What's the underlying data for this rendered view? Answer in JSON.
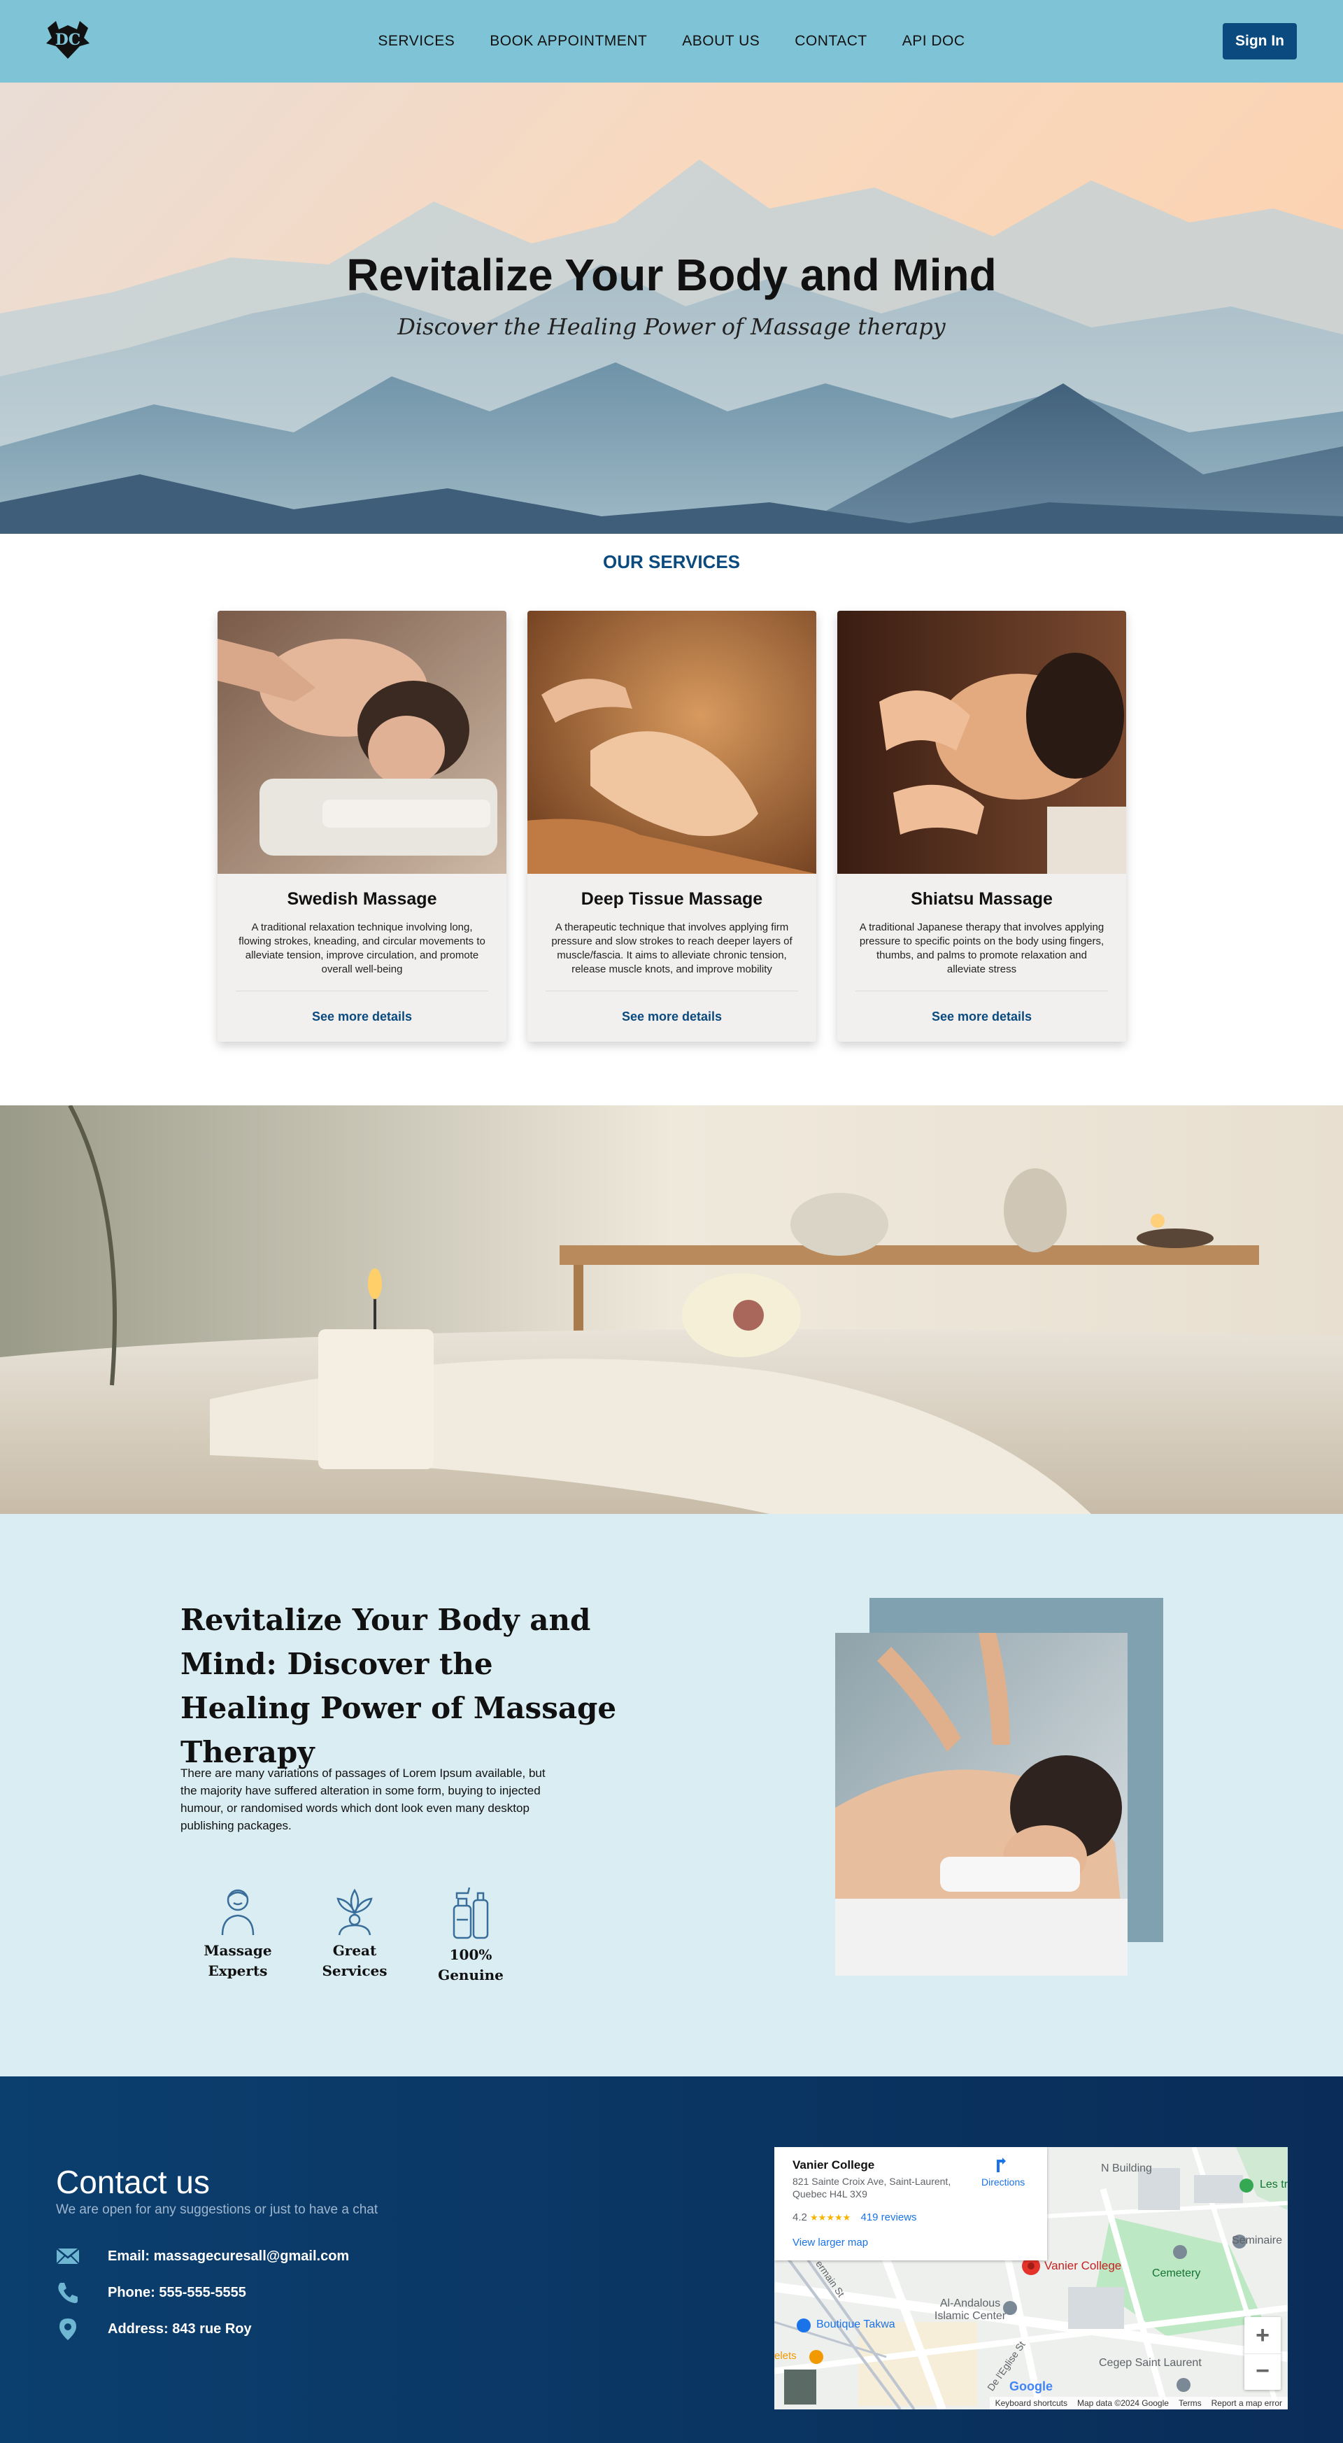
{
  "header": {
    "nav": [
      "SERVICES",
      "BOOK APPOINTMENT",
      "ABOUT US",
      "CONTACT",
      "API DOC"
    ],
    "sign_in": "Sign In"
  },
  "hero": {
    "title": "Revitalize Your Body and Mind",
    "subtitle": "Discover the Healing Power of Massage therapy"
  },
  "services": {
    "title": "OUR SERVICES",
    "cards": [
      {
        "title": "Swedish Massage",
        "desc": "A traditional relaxation technique involving long, flowing strokes, kneading, and circular movements to alleviate tension, improve circulation, and promote overall well-being",
        "link": "See more details"
      },
      {
        "title": "Deep Tissue Massage",
        "desc": "A therapeutic technique that involves applying firm pressure and slow strokes to reach deeper layers of muscle/fascia. It aims to alleviate chronic tension, release muscle knots, and improve mobility",
        "link": "See more details"
      },
      {
        "title": "Shiatsu Massage",
        "desc": "A traditional Japanese therapy that involves applying pressure to specific points on the body using fingers, thumbs, and palms to promote relaxation and alleviate stress",
        "link": "See more details"
      }
    ]
  },
  "about": {
    "title": "Revitalize Your Body and Mind: Discover the Healing Power of Massage Therapy",
    "body": "There are many variations of passages of Lorem Ipsum available, but the majority have suffered alteration in some form, buying to injected humour, or randomised words which dont look even many desktop publishing packages.",
    "features": [
      {
        "icon": "therapist-icon",
        "label": "Massage Experts"
      },
      {
        "icon": "lotus-icon",
        "label": "Great Services"
      },
      {
        "icon": "bottles-icon",
        "label": "100% Genuine"
      }
    ]
  },
  "contact": {
    "title": "Contact us",
    "subtitle": "We are open for any suggestions or just to have a chat",
    "email": "Email: massagecuresall@gmail.com",
    "phone": "Phone: 555-555-5555",
    "address": "Address: 843 rue Roy"
  },
  "map": {
    "place": "Vanier College",
    "address": "821 Sainte Croix Ave, Saint-Laurent, Quebec H4L 3X9",
    "rating": "4.2",
    "stars": "★★★★★",
    "reviews": "419 reviews",
    "directions": "Directions",
    "larger": "View larger map",
    "marker_label": "Vanier College",
    "labels": [
      "N Building",
      "Les tr",
      "Seminaire",
      "Cemetery",
      "Al-Andalous Islamic Center",
      "Boutique Takwa",
      "Cegep Saint Laurent",
      "De l'Eglise St",
      "ermain St",
      "elets"
    ],
    "zoom_in": "+",
    "zoom_out": "−",
    "footer": [
      "Keyboard shortcuts",
      "Map data ©2024 Google",
      "Terms",
      "Report a map error"
    ],
    "brand": "Google"
  }
}
